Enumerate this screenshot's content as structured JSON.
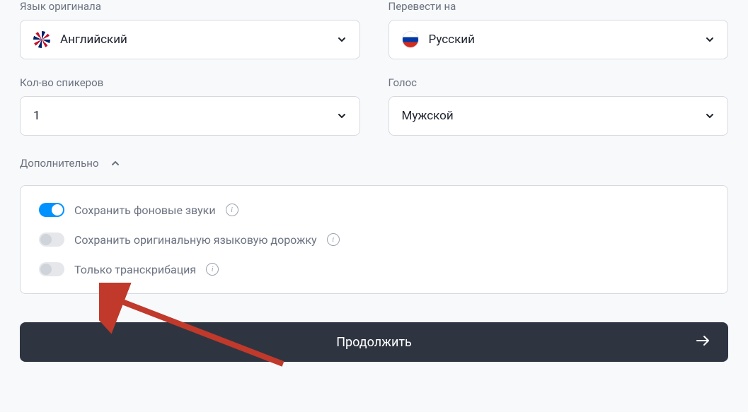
{
  "sourceLanguage": {
    "label": "Язык оригинала",
    "value": "Английский"
  },
  "targetLanguage": {
    "label": "Перевести на",
    "value": "Русский"
  },
  "speakers": {
    "label": "Кол-во спикеров",
    "value": "1"
  },
  "voice": {
    "label": "Голос",
    "value": "Мужской"
  },
  "additional": {
    "label": "Дополнительно",
    "options": {
      "keepBackground": {
        "label": "Сохранить фоновые звуки",
        "enabled": true
      },
      "keepOriginalAudio": {
        "label": "Сохранить оригинальную языковую дорожку",
        "enabled": false
      },
      "transcriptionOnly": {
        "label": "Только транскрибация",
        "enabled": false
      }
    }
  },
  "continueButton": "Продолжить"
}
